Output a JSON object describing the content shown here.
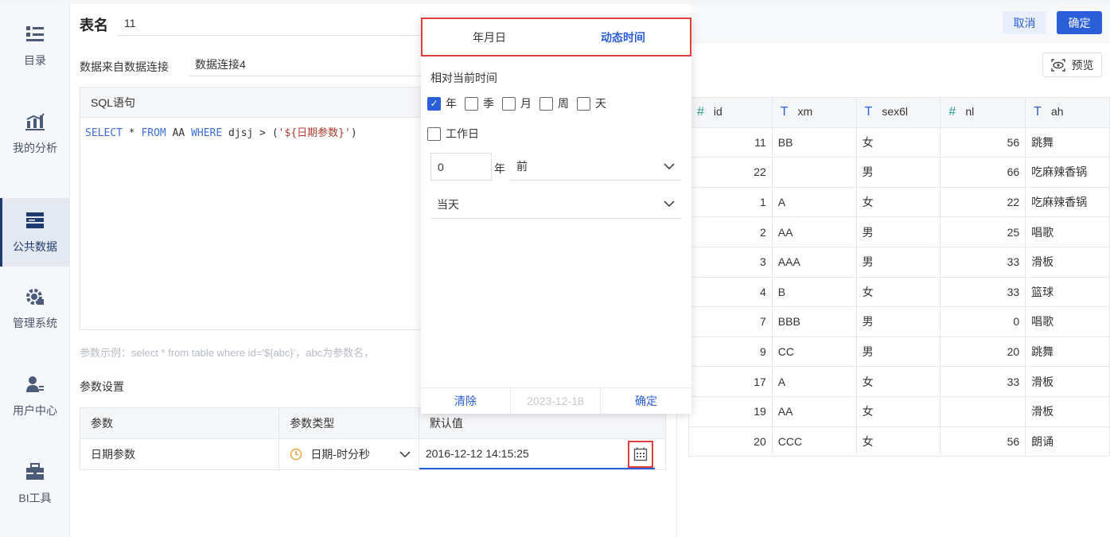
{
  "sidebar": {
    "items": [
      {
        "label": "目录",
        "icon": "catalog-icon"
      },
      {
        "label": "我的分析",
        "icon": "analysis-icon"
      },
      {
        "label": "公共数据",
        "icon": "public-data-icon"
      },
      {
        "label": "管理系统",
        "icon": "settings-gear-icon"
      },
      {
        "label": "用户中心",
        "icon": "user-icon"
      },
      {
        "label": "BI工具",
        "icon": "toolbox-icon"
      }
    ],
    "active_index": 2
  },
  "header": {
    "title": "表名",
    "name_value": "11",
    "cancel_label": "取消",
    "ok_label": "确定"
  },
  "source": {
    "label": "数据来自数据连接",
    "value": "数据连接4"
  },
  "sql": {
    "header": "SQL语句",
    "kw_select": "SELECT",
    "tok_star": " * ",
    "kw_from": "FROM",
    "tok_table": " AA ",
    "kw_where": "WHERE",
    "tok_cond": " djsj > (",
    "tok_param": "'${日期参数}'",
    "tok_close": ")"
  },
  "hint": "参数示例：select * from table where id='${abc}'，abc为参数名，",
  "params": {
    "title": "参数设置",
    "columns": [
      "参数",
      "参数类型",
      "默认值"
    ],
    "row": {
      "name": "日期参数",
      "type": "日期-时分秒",
      "default": "2016-12-12 14:15:25"
    }
  },
  "preview": {
    "button": "预览",
    "columns": [
      {
        "name": "id",
        "kind": "number"
      },
      {
        "name": "xm",
        "kind": "text"
      },
      {
        "name": "sex6l",
        "kind": "text"
      },
      {
        "name": "nl",
        "kind": "number"
      },
      {
        "name": "ah",
        "kind": "text"
      }
    ],
    "rows": [
      [
        "11",
        "BB",
        "女",
        "56",
        "跳舞"
      ],
      [
        "22",
        "",
        "男",
        "66",
        "吃麻辣香锅"
      ],
      [
        "1",
        "A",
        "女",
        "22",
        "吃麻辣香锅"
      ],
      [
        "2",
        "AA",
        "男",
        "25",
        "唱歌"
      ],
      [
        "3",
        "AAA",
        "男",
        "33",
        "滑板"
      ],
      [
        "4",
        "B",
        "女",
        "33",
        "篮球"
      ],
      [
        "7",
        "BBB",
        "男",
        "0",
        "唱歌"
      ],
      [
        "9",
        "CC",
        "男",
        "20",
        "跳舞"
      ],
      [
        "17",
        "A",
        "女",
        "33",
        "滑板"
      ],
      [
        "19",
        "AA",
        "女",
        "",
        "滑板"
      ],
      [
        "20",
        "CCC",
        "女",
        "56",
        "朗诵"
      ]
    ]
  },
  "popup": {
    "tabs": [
      "年月日",
      "动态时间"
    ],
    "active_tab": 1,
    "relative_label": "相对当前时间",
    "units": [
      {
        "label": "年",
        "checked": true
      },
      {
        "label": "季",
        "checked": false
      },
      {
        "label": "月",
        "checked": false
      },
      {
        "label": "周",
        "checked": false
      },
      {
        "label": "天",
        "checked": false
      }
    ],
    "workday_label": "工作日",
    "offset_value": "0",
    "offset_unit": "年",
    "direction": "前",
    "anchor": "当天",
    "footer": {
      "clear": "清除",
      "date": "2023-12-18",
      "confirm": "确定"
    }
  },
  "colors": {
    "accent": "#2b5fd9",
    "highlight": "#e23c3c"
  }
}
